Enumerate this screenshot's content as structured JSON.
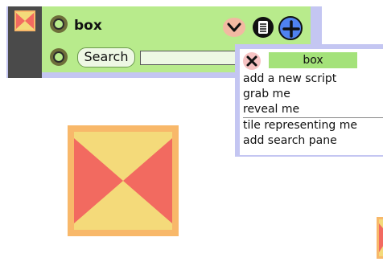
{
  "viewer": {
    "title": "box",
    "search_label": "Search",
    "search_value": "",
    "thumbnail_icon": "box-thumbnail-icon",
    "menu_icon": "chevron-down-icon",
    "tile_icon": "sheet-icon",
    "add_icon": "plus-icon"
  },
  "menu": {
    "title": "box",
    "close_icon": "close-icon",
    "items": [
      "add a new script",
      "grab me",
      "reveal me",
      "tile representing me",
      "add search pane"
    ]
  },
  "colors": {
    "box_fill": "#f4da7a",
    "box_border": "#f8b86a",
    "box_bowtie": "#f26a60",
    "viewer_bg": "#c4c6f2",
    "viewer_row": "#b8eb8c"
  }
}
